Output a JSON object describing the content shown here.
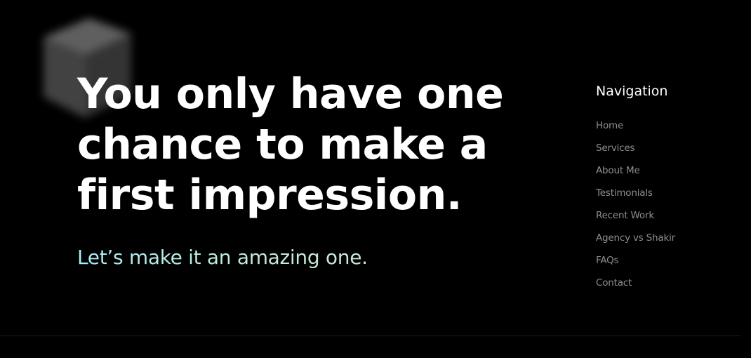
{
  "hero": {
    "headline_lines": [
      "You only have one",
      "chance to make a",
      "first impression."
    ],
    "subheadline": "Let’s make it an amazing one."
  },
  "navigation": {
    "title": "Navigation",
    "items": [
      {
        "label": "Home"
      },
      {
        "label": "Services"
      },
      {
        "label": "About Me"
      },
      {
        "label": "Testimonials"
      },
      {
        "label": "Recent Work"
      },
      {
        "label": "Agency vs Shakir"
      },
      {
        "label": "FAQs"
      },
      {
        "label": "Contact"
      }
    ]
  },
  "decor": {
    "icon": "cube-icon"
  },
  "colors": {
    "background": "#000000",
    "headline": "#ffffff",
    "subheadline_gradient_start": "#a9ecf8",
    "subheadline_gradient_end": "#cfe9d8",
    "nav_title": "#ffffff",
    "nav_link": "#8e8e8e"
  }
}
